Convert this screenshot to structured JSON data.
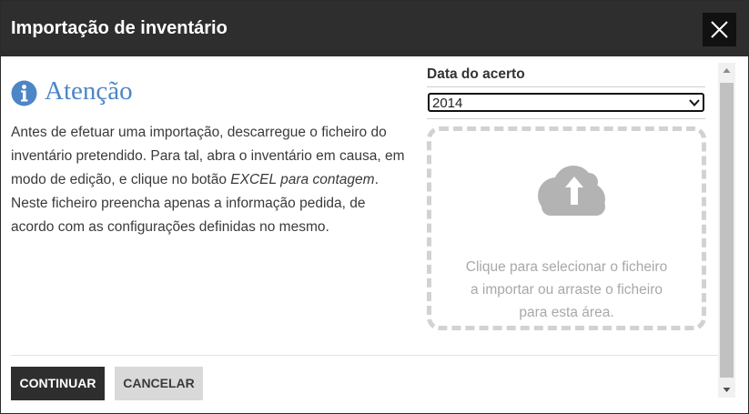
{
  "dialog": {
    "title": "Importação de inventário",
    "close_icon": "close-x-icon"
  },
  "attention": {
    "icon": "info-circle-icon",
    "heading": "Atenção",
    "text_1": "Antes de efetuar uma importação, descarregue o ficheiro do inventário pretendido. Para tal, abra o inventário em causa, em modo de edição, e clique no botão ",
    "text_em": "EXCEL para contagem",
    "text_2": ". Neste ficheiro preencha apenas a informação pedida, de acordo com as configurações definidas no mesmo."
  },
  "date": {
    "label": "Data do acerto",
    "selected_year": "2014"
  },
  "upload": {
    "icon": "cloud-upload-icon",
    "text_line_1": "Clique para selecionar o ficheiro",
    "text_line_2": "a importar ou arraste o ficheiro",
    "text_line_3": "para esta área."
  },
  "buttons": {
    "continue": "CONTINUAR",
    "cancel": "CANCELAR"
  },
  "colors": {
    "titlebar": "#2e2e2e",
    "accent_blue": "#4d86c6",
    "dropzone_border": "#d2d2d2"
  }
}
